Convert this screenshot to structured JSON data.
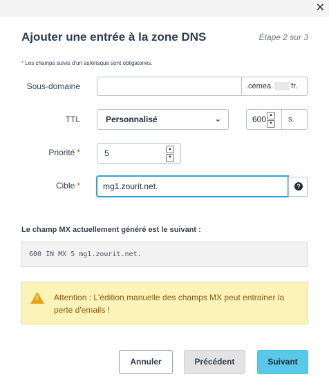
{
  "dialog": {
    "title": "Ajouter une entrée à la zone DNS",
    "step": "Étape 2 sur 3",
    "close_icon": "close-icon"
  },
  "required_note": {
    "star": "*",
    "text": "Les champs suivis d'un astérisque sont obligatoires."
  },
  "form": {
    "subdomain": {
      "label": "Sous-domaine",
      "value": "",
      "suffix_start": ".cemea.",
      "suffix_end": "fr."
    },
    "ttl": {
      "label": "TTL",
      "select_value": "Personnalisé",
      "value": "600",
      "unit": "s."
    },
    "priority": {
      "label": "Priorité",
      "required_star": "*",
      "value": "5"
    },
    "target": {
      "label": "Cible",
      "required_star": "*",
      "value": "mg1.zourit.net.",
      "help_icon": "question-circle-icon"
    }
  },
  "mx_preview": {
    "label": "Le champ MX actuellement généré est le suivant :",
    "value": "600 IN MX 5 mg1.zourit.net."
  },
  "warning": {
    "icon": "warning-triangle-icon",
    "text": "Attention : L'édition manuelle des champs MX peut entrainer la perte d'emails !",
    "color": "#fcf3b8"
  },
  "buttons": {
    "cancel": "Annuler",
    "previous": "Précédent",
    "next": "Suivant",
    "next_color": "#5ac8e8"
  }
}
